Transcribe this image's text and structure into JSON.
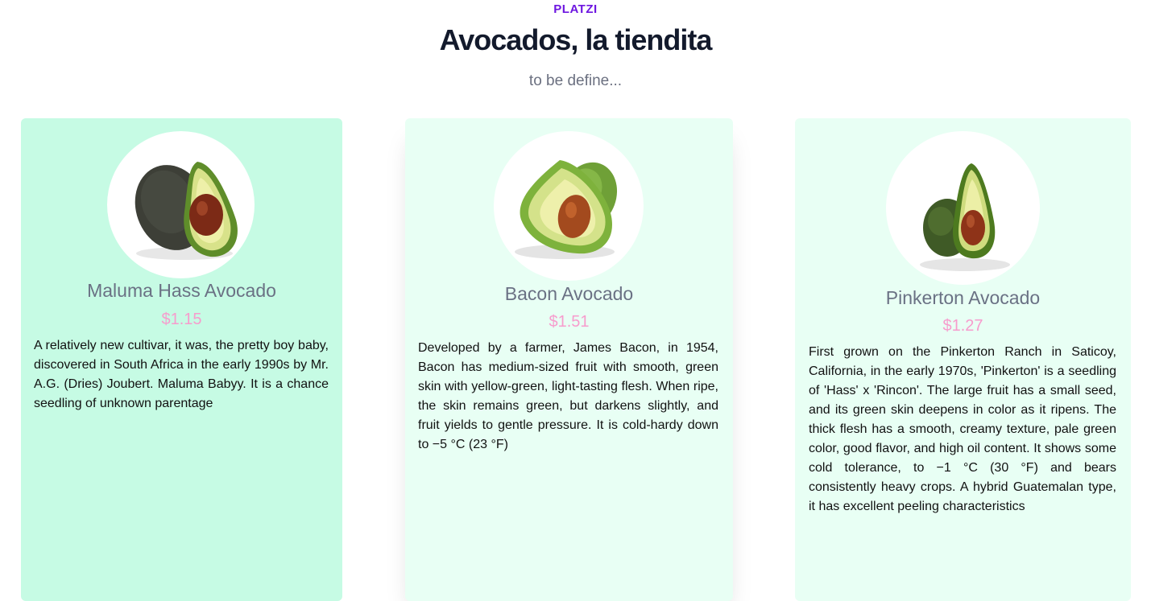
{
  "header": {
    "brand": "PLATZI",
    "title": "Avocados, la tiendita",
    "subtitle": "to be define..."
  },
  "products": [
    {
      "name": "Maluma Hass Avocado",
      "price": "$1.15",
      "description": "A relatively new cultivar, it was, the pretty boy baby, discovered in South Africa in the early 1990s by Mr. A.G. (Dries) Joubert. Maluma Babyy. It is a chance seedling of unknown parentage",
      "image_icon": "avocado-hass-icon"
    },
    {
      "name": "Bacon Avocado",
      "price": "$1.51",
      "description": "Developed by a farmer, James Bacon, in 1954, Bacon has medium-sized fruit with smooth, green skin with yellow-green, light-tasting flesh. When ripe, the skin remains green, but darkens slightly, and fruit yields to gentle pressure. It is cold-hardy down to −5 °C (23 °F)",
      "image_icon": "avocado-bacon-icon"
    },
    {
      "name": "Pinkerton Avocado",
      "price": "$1.27",
      "description": "First grown on the Pinkerton Ranch in Saticoy, California, in the early 1970s, 'Pinkerton' is a seedling of 'Hass' x 'Rincon'. The large fruit has a small seed, and its green skin deepens in color as it ripens. The thick flesh has a smooth, creamy texture, pale green color, good flavor, and high oil content. It shows some cold tolerance, to −1 °C (30 °F) and bears consistently heavy crops. A hybrid Guatemalan type, it has excellent peeling characteristics",
      "image_icon": "avocado-pinkerton-icon"
    }
  ],
  "colors": {
    "brand": "#6d16e0",
    "title": "#131a2c",
    "price": "#f79ccd",
    "card_active": "#c6fbe4",
    "card": "#e8fff4"
  }
}
